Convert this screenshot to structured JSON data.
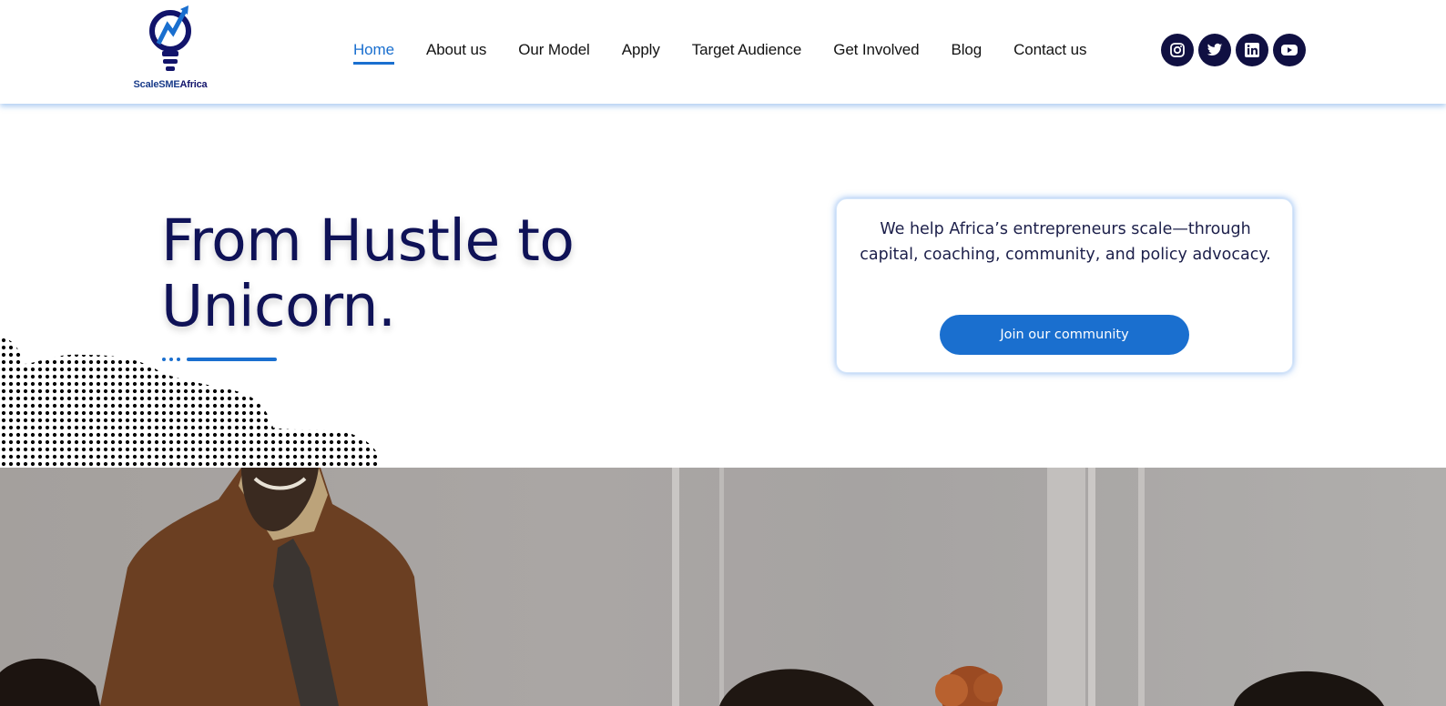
{
  "logo": {
    "name_part1": "ScaleSME",
    "name_part2": "Africa"
  },
  "nav": {
    "items": [
      {
        "label": "Home",
        "active": true
      },
      {
        "label": "About us",
        "active": false
      },
      {
        "label": "Our Model",
        "active": false
      },
      {
        "label": "Apply",
        "active": false
      },
      {
        "label": "Target Audience",
        "active": false
      },
      {
        "label": "Get Involved",
        "active": false
      },
      {
        "label": "Blog",
        "active": false
      },
      {
        "label": "Contact us",
        "active": false
      }
    ]
  },
  "social": {
    "icons": [
      "instagram-icon",
      "twitter-icon",
      "linkedin-icon",
      "youtube-icon"
    ]
  },
  "hero": {
    "title_line1": "From Hustle to",
    "title_line2": "Unicorn."
  },
  "card": {
    "text": "We help Africa’s entrepreneurs scale—through capital, coaching, community, and policy advocacy.",
    "button_label": "Join our community"
  },
  "colors": {
    "accent": "#1a6fcf",
    "navy": "#0f1257",
    "social_bg": "#101042"
  }
}
